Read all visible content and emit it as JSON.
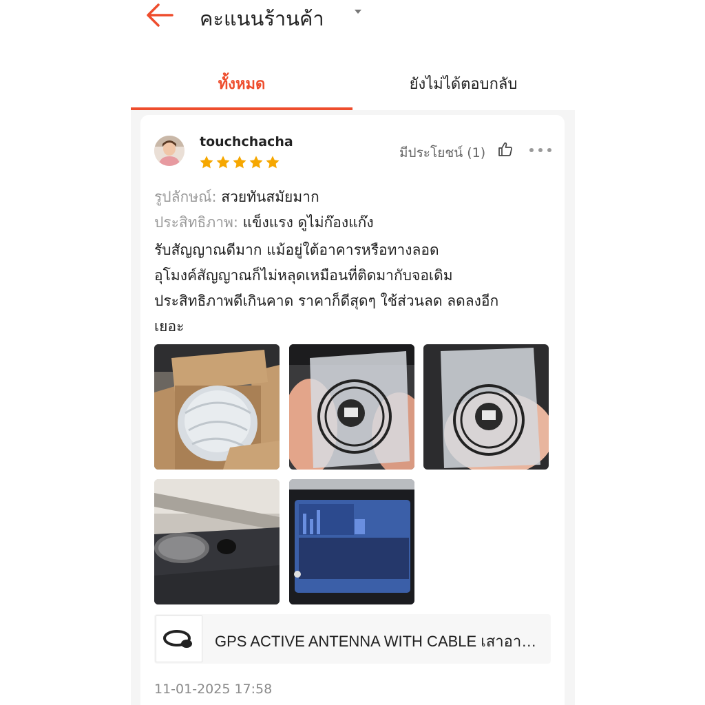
{
  "header": {
    "title": "คะแนนร้านค้า",
    "back_icon": "arrow-left-icon",
    "dropdown_icon": "caret-down-icon",
    "accent_color": "#ee4d2d"
  },
  "tabs": [
    {
      "label": "ทั้งหมด",
      "active": true
    },
    {
      "label": "ยังไม่ได้ตอบกลับ",
      "active": false
    }
  ],
  "review": {
    "username": "touchchacha",
    "rating": 5,
    "helpful_label": "มีประโยชน์ (1)",
    "attributes": [
      {
        "label": "รูปลักษณ์:",
        "value": "สวยทันสมัยมาก"
      },
      {
        "label": "ประสิทธิภาพ:",
        "value": "แข็งแรง ดูไม่ก๊องแก๊ง"
      }
    ],
    "text_lines": [
      "รับสัญญาณดีมาก แม้อยู่ใต้อาคารหรือทางลอด",
      "อุโมงค์สัญญาณก็ไม่หลุดเหมือนที่ติดมากับจอ￼เดิม",
      "ประสิทธิภาพดีเกินคาด ราคาก็ดีสุดๆ ใช้ส่วนลด ลดลงอีก",
      "เยอะ"
    ],
    "photos": [
      "photo-box-package",
      "photo-antenna-bag-1",
      "photo-antenna-bag-2",
      "photo-dashboard-mount",
      "photo-head-unit-screen"
    ],
    "product_name": "GPS ACTIVE ANTENNA WITH CABLE  เสาอากาศ GPS",
    "timestamp": "11-01-2025 17:58"
  }
}
